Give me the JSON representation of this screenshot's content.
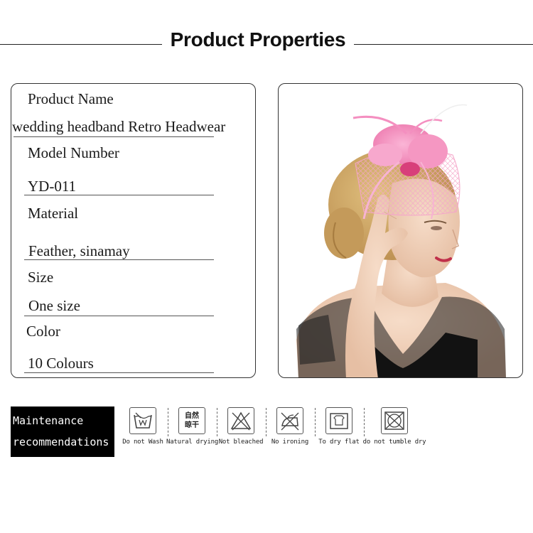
{
  "header": {
    "title": "Product Properties"
  },
  "properties": {
    "product_name_label": "Product Name",
    "product_name_value": "wedding headband Retro Headwear",
    "model_number_label": "Model Number",
    "model_number_value": "YD-011",
    "material_label": "Material",
    "material_value": "Feather, sinamay",
    "size_label": "Size",
    "size_value": "One size",
    "color_label": "Color",
    "color_value": "10 Colours"
  },
  "maintenance": {
    "title_line1": "Maintenance",
    "title_line2": "recommendations",
    "items": [
      {
        "icon": "do-not-wash-icon",
        "label": "Do not Wash"
      },
      {
        "icon": "natural-drying-icon",
        "label": "Natural drying",
        "icon_text_line1": "自然",
        "icon_text_line2": "晾干"
      },
      {
        "icon": "no-bleach-icon",
        "label": "Not bleached"
      },
      {
        "icon": "no-ironing-icon",
        "label": "No ironing"
      },
      {
        "icon": "dry-flat-icon",
        "label": "To dry flat"
      },
      {
        "icon": "no-tumble-dry-icon",
        "label": "do not tumble dry"
      }
    ]
  },
  "colors": {
    "accent_pink": "#f48fc0",
    "text": "#1a1a1a",
    "badge_bg": "#000000"
  }
}
